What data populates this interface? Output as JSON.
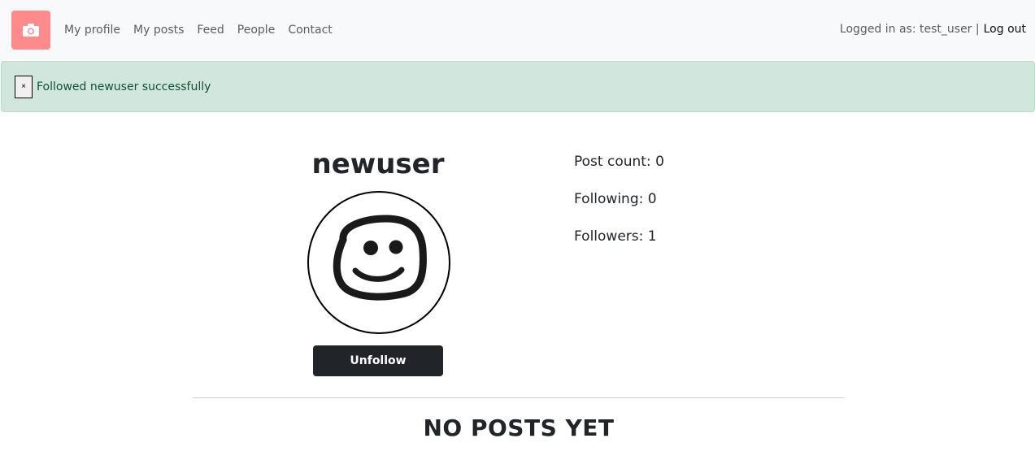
{
  "nav": {
    "links": [
      "My profile",
      "My posts",
      "Feed",
      "People",
      "Contact"
    ],
    "logged_in_text": "Logged in as: test_user |",
    "logout_label": "Log out",
    "brand_color": "#ff8a8a"
  },
  "alert": {
    "close_symbol": "×",
    "message": "Followed newuser successfully"
  },
  "profile": {
    "username": "newuser",
    "avatar_icon": "smiley-face-icon",
    "button_label": "Unfollow",
    "stats": {
      "post_count": "Post count: 0",
      "following": "Following: 0",
      "followers": "Followers: 1"
    }
  },
  "posts": {
    "empty_message": "NO POSTS YET"
  }
}
